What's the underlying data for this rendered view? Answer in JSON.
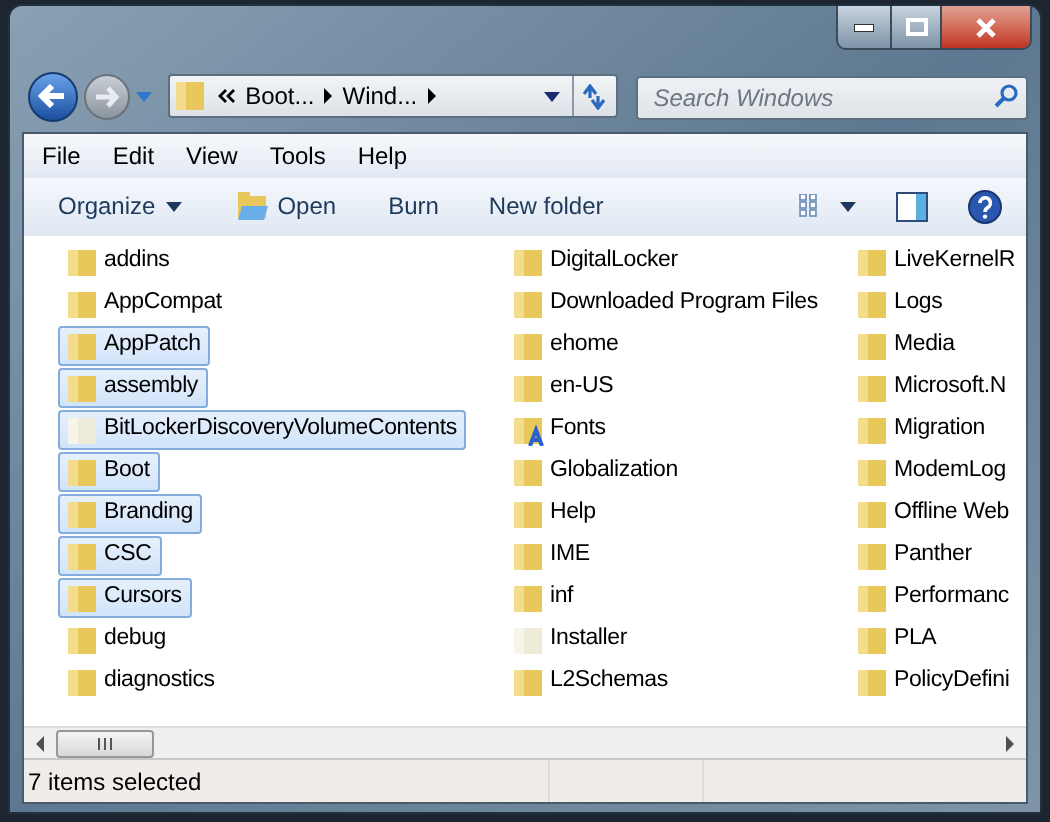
{
  "address": {
    "segments": [
      {
        "text": "Boot..."
      },
      {
        "text": "Wind..."
      }
    ]
  },
  "search": {
    "placeholder": "Search Windows"
  },
  "menu": [
    "File",
    "Edit",
    "View",
    "Tools",
    "Help"
  ],
  "toolbar": [
    {
      "label": "Organize",
      "kind": "dropdown"
    },
    {
      "label": "Open",
      "kind": "icon"
    },
    {
      "label": "Burn",
      "kind": "plain"
    },
    {
      "label": "New folder",
      "kind": "plain"
    }
  ],
  "columns": [
    [
      {
        "name": "addins",
        "kind": "folder",
        "selected": false
      },
      {
        "name": "AppCompat",
        "kind": "folder",
        "selected": false
      },
      {
        "name": "AppPatch",
        "kind": "folder",
        "selected": true
      },
      {
        "name": "assembly",
        "kind": "folder",
        "selected": true
      },
      {
        "name": "BitLockerDiscoveryVolumeContents",
        "kind": "hidden",
        "selected": true
      },
      {
        "name": "Boot",
        "kind": "folder",
        "selected": true
      },
      {
        "name": "Branding",
        "kind": "folder",
        "selected": true
      },
      {
        "name": "CSC",
        "kind": "folder",
        "selected": true
      },
      {
        "name": "Cursors",
        "kind": "folder",
        "selected": true
      },
      {
        "name": "debug",
        "kind": "folder",
        "selected": false
      },
      {
        "name": "diagnostics",
        "kind": "folder",
        "selected": false
      }
    ],
    [
      {
        "name": "DigitalLocker",
        "kind": "folder",
        "selected": false
      },
      {
        "name": "Downloaded Program Files",
        "kind": "folder",
        "selected": false
      },
      {
        "name": "ehome",
        "kind": "folder",
        "selected": false
      },
      {
        "name": "en-US",
        "kind": "folder",
        "selected": false
      },
      {
        "name": "Fonts",
        "kind": "fonts",
        "selected": false
      },
      {
        "name": "Globalization",
        "kind": "folder",
        "selected": false
      },
      {
        "name": "Help",
        "kind": "folder",
        "selected": false
      },
      {
        "name": "IME",
        "kind": "folder",
        "selected": false
      },
      {
        "name": "inf",
        "kind": "folder",
        "selected": false
      },
      {
        "name": "Installer",
        "kind": "hidden",
        "selected": false
      },
      {
        "name": "L2Schemas",
        "kind": "folder",
        "selected": false
      }
    ],
    [
      {
        "name": "LiveKernelR",
        "kind": "folder",
        "selected": false
      },
      {
        "name": "Logs",
        "kind": "folder",
        "selected": false
      },
      {
        "name": "Media",
        "kind": "folder",
        "selected": false
      },
      {
        "name": "Microsoft.N",
        "kind": "folder",
        "selected": false
      },
      {
        "name": "Migration",
        "kind": "folder",
        "selected": false
      },
      {
        "name": "ModemLog",
        "kind": "folder",
        "selected": false
      },
      {
        "name": "Offline Web",
        "kind": "folder",
        "selected": false
      },
      {
        "name": "Panther",
        "kind": "folder",
        "selected": false
      },
      {
        "name": "Performanc",
        "kind": "folder",
        "selected": false
      },
      {
        "name": "PLA",
        "kind": "folder",
        "selected": false
      },
      {
        "name": "PolicyDefini",
        "kind": "folder",
        "selected": false
      }
    ]
  ],
  "status_bar": {
    "text": "7 items selected"
  }
}
